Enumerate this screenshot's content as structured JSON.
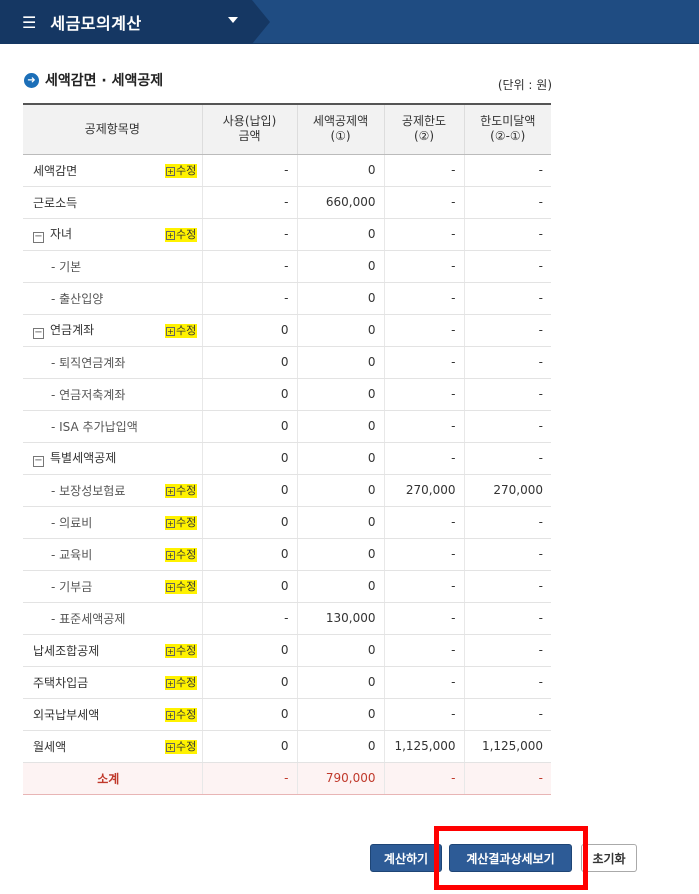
{
  "topbar": {
    "title": "세금모의계산"
  },
  "section": {
    "title": "세액감면 · 세액공제",
    "unit": "(단위 : 원)"
  },
  "table": {
    "headers": {
      "item": "공제항목명",
      "paid_line1": "사용(납입)",
      "paid_line2": "금액",
      "credit_line1": "세액공제액",
      "credit_line2": "(①)",
      "limit_line1": "공제한도",
      "limit_line2": "(②)",
      "unreached_line1": "한도미달액",
      "unreached_line2": "(②-①)"
    },
    "edit_label": "수정",
    "rows": [
      {
        "name": "세액감면",
        "edit": true,
        "paid": "-",
        "credit": "0",
        "limit": "-",
        "unreached": "-"
      },
      {
        "name": "근로소득",
        "edit": false,
        "paid": "-",
        "credit": "660,000",
        "limit": "-",
        "unreached": "-"
      },
      {
        "name": "자녀",
        "edit": true,
        "toggle": true,
        "paid": "-",
        "credit": "0",
        "limit": "-",
        "unreached": "-"
      },
      {
        "name": "- 기본",
        "sub": true,
        "edit": false,
        "paid": "-",
        "credit": "0",
        "limit": "-",
        "unreached": "-"
      },
      {
        "name": "- 출산입양",
        "sub": true,
        "edit": false,
        "paid": "-",
        "credit": "0",
        "limit": "-",
        "unreached": "-"
      },
      {
        "name": "연금계좌",
        "edit": true,
        "toggle": true,
        "paid": "0",
        "credit": "0",
        "limit": "-",
        "unreached": "-"
      },
      {
        "name": "- 퇴직연금계좌",
        "sub": true,
        "edit": false,
        "paid": "0",
        "credit": "0",
        "limit": "-",
        "unreached": "-"
      },
      {
        "name": "- 연금저축계좌",
        "sub": true,
        "edit": false,
        "paid": "0",
        "credit": "0",
        "limit": "-",
        "unreached": "-"
      },
      {
        "name": "- ISA 추가납입액",
        "sub": true,
        "edit": false,
        "paid": "0",
        "credit": "0",
        "limit": "-",
        "unreached": "-"
      },
      {
        "name": "특별세액공제",
        "edit": false,
        "toggle": true,
        "paid": "0",
        "credit": "0",
        "limit": "-",
        "unreached": "-"
      },
      {
        "name": "- 보장성보험료",
        "sub": true,
        "edit": true,
        "paid": "0",
        "credit": "0",
        "limit": "270,000",
        "unreached": "270,000"
      },
      {
        "name": "- 의료비",
        "sub": true,
        "edit": true,
        "paid": "0",
        "credit": "0",
        "limit": "-",
        "unreached": "-"
      },
      {
        "name": "- 교육비",
        "sub": true,
        "edit": true,
        "paid": "0",
        "credit": "0",
        "limit": "-",
        "unreached": "-"
      },
      {
        "name": "- 기부금",
        "sub": true,
        "edit": true,
        "paid": "0",
        "credit": "0",
        "limit": "-",
        "unreached": "-"
      },
      {
        "name": "- 표준세액공제",
        "sub": true,
        "edit": false,
        "paid": "-",
        "credit": "130,000",
        "limit": "-",
        "unreached": "-"
      },
      {
        "name": "납세조합공제",
        "edit": true,
        "paid": "0",
        "credit": "0",
        "limit": "-",
        "unreached": "-"
      },
      {
        "name": "주택차입금",
        "edit": true,
        "paid": "0",
        "credit": "0",
        "limit": "-",
        "unreached": "-"
      },
      {
        "name": "외국납부세액",
        "edit": true,
        "paid": "0",
        "credit": "0",
        "limit": "-",
        "unreached": "-"
      },
      {
        "name": "월세액",
        "edit": true,
        "paid": "0",
        "credit": "0",
        "limit": "1,125,000",
        "unreached": "1,125,000"
      }
    ],
    "total": {
      "name": "소계",
      "paid": "-",
      "credit": "790,000",
      "limit": "-",
      "unreached": "-"
    }
  },
  "buttons": {
    "calc": "계산하기",
    "detail": "계산결과상세보기",
    "reset": "초기화"
  },
  "colors": {
    "topbar": "#1f4c82",
    "button": "#2d5b96",
    "highlight": "#ff0000",
    "edit_highlight": "#fff200"
  }
}
